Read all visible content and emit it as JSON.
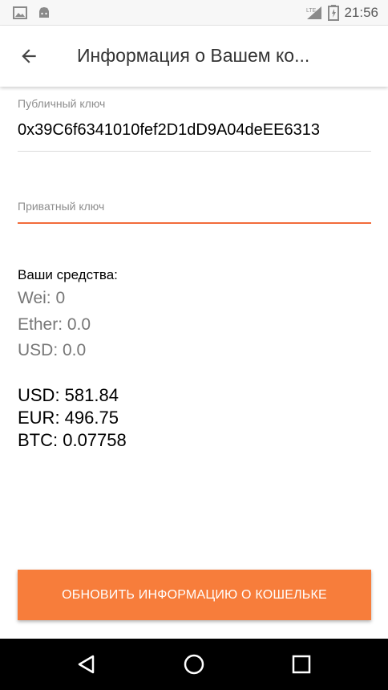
{
  "status_bar": {
    "time": "21:56",
    "network": "LTE",
    "icons": [
      "image-icon",
      "android-icon",
      "signal-icon",
      "battery-icon"
    ]
  },
  "toolbar": {
    "back_icon": "arrow-back-icon",
    "title": "Информация о Вашем ко..."
  },
  "public_key": {
    "label": "Публичный ключ",
    "value": "0x39C6f6341010fef2D1dD9A04deEE6313"
  },
  "private_key": {
    "placeholder": "Приватный ключ",
    "value": ""
  },
  "balance": {
    "title": "Ваши средства:",
    "wei": "Wei: 0",
    "ether": "Ether: 0.0",
    "usd": "USD: 0.0"
  },
  "rates": {
    "usd": "USD: 581.84",
    "eur": "EUR: 496.75",
    "btc": "BTC: 0.07758"
  },
  "refresh_button": {
    "label": "ОБНОВИТЬ ИНФОРМАЦИЮ О КОШЕЛЬКЕ"
  },
  "colors": {
    "accent": "#f77d3b",
    "accent_line": "#f26b3a"
  },
  "nav_bar": {
    "icons": [
      "back-triangle-icon",
      "home-circle-icon",
      "recents-square-icon"
    ]
  }
}
